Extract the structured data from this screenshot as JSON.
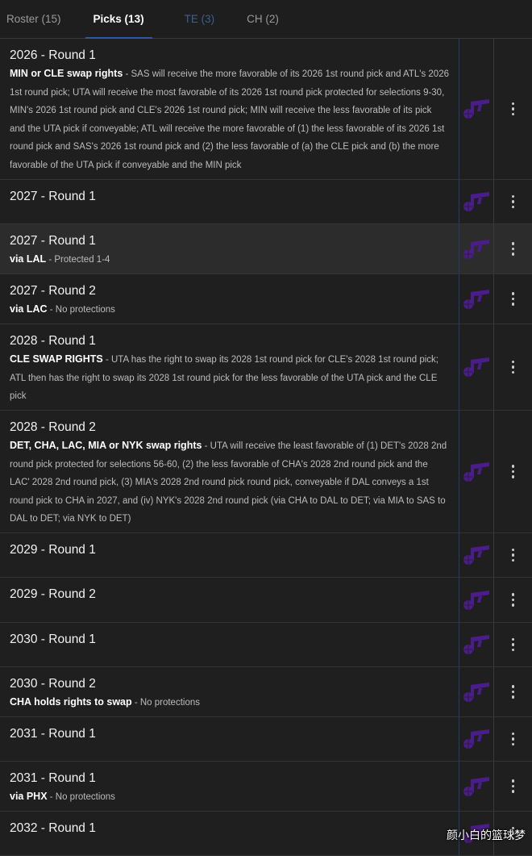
{
  "tabs": [
    {
      "label": "Roster (15)"
    },
    {
      "label": "Picks (13)"
    },
    {
      "label": "TE (3)"
    },
    {
      "label": "CH (2)"
    }
  ],
  "picks": [
    {
      "title": "2026 - Round 1",
      "note_label": "MIN or CLE swap rights",
      "note_detail": " - SAS will receive the more favorable of its 2026 1st round pick and ATL's 2026 1st round pick; UTA will receive the most favorable of its 2026 1st round pick protected for selections 9-30, MIN's 2026 1st round pick and CLE's 2026 1st round pick; MIN will receive the less favorable of its pick and the UTA pick if conveyable; ATL will receive the more favorable of (1) the less favorable of its 2026 1st round pick and SAS's 2026 1st round pick and (2) the less favorable of (a) the CLE pick and (b) the more favorable of the UTA pick if conveyable and the MIN pick"
    },
    {
      "title": "2027 - Round 1",
      "note_label": "",
      "note_detail": ""
    },
    {
      "title": "2027 - Round 1",
      "note_label": "via LAL",
      "note_detail": " - Protected 1-4"
    },
    {
      "title": "2027 - Round 2",
      "note_label": "via LAC",
      "note_detail": " - No protections"
    },
    {
      "title": "2028 - Round 1",
      "note_label": "CLE SWAP RIGHTS",
      "note_detail": " - UTA has the right to swap its 2028 1st round pick for CLE's 2028 1st round pick; ATL then has the right to swap its 2028 1st round pick for the less favorable of the UTA pick and the CLE pick"
    },
    {
      "title": "2028 - Round 2",
      "note_label": "DET, CHA, LAC, MIA or NYK swap rights",
      "note_detail": " - UTA will receive the least favorable of (1) DET's 2028 2nd round pick protected for selections 56-60, (2) the less favorable of CHA's 2028 2nd round pick and the LAC' 2028 2nd round pick, (3) MIA's 2028 2nd round pick round pick, conveyable if DAL conveys a 1st round pick to CHA in 2027, and (iv) NYK's 2028 2nd round pick (via CHA to DAL to DET; via MIA to SAS to DAL to DET; via NYK to DET)"
    },
    {
      "title": "2029 - Round 1",
      "note_label": "",
      "note_detail": ""
    },
    {
      "title": "2029 - Round 2",
      "note_label": "",
      "note_detail": ""
    },
    {
      "title": "2030 - Round 1",
      "note_label": "",
      "note_detail": ""
    },
    {
      "title": "2030 - Round 2",
      "note_label": "CHA holds rights to swap",
      "note_detail": " - No protections"
    },
    {
      "title": "2031 - Round 1",
      "note_label": "",
      "note_detail": ""
    },
    {
      "title": "2031 - Round 1",
      "note_label": "via PHX",
      "note_detail": " - No protections"
    },
    {
      "title": "2032 - Round 1",
      "note_label": "",
      "note_detail": ""
    }
  ],
  "team_logo": {
    "icon": "utah-jazz-note-icon",
    "color": "#4b1d8c"
  },
  "watermark": "颜小白的篮球梦"
}
